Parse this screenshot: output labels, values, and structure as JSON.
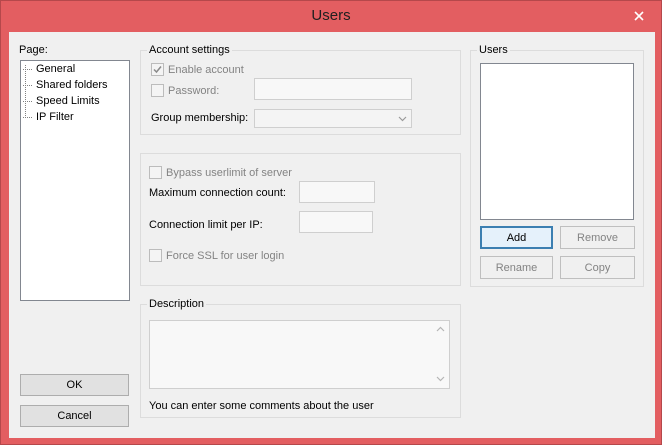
{
  "window": {
    "title": "Users",
    "close_glyph": "close-icon"
  },
  "page_panel": {
    "label": "Page:",
    "items": [
      "General",
      "Shared folders",
      "Speed Limits",
      "IP Filter"
    ]
  },
  "account_settings": {
    "group_label": "Account settings",
    "enable_account_label": "Enable account",
    "enable_account_checked": true,
    "password_label": "Password:",
    "password_checked": false,
    "password_value": "",
    "group_membership_label": "Group membership:",
    "group_membership_value": ""
  },
  "limits": {
    "bypass_label": "Bypass userlimit of server",
    "bypass_checked": false,
    "max_conn_label": "Maximum connection count:",
    "max_conn_value": "",
    "conn_per_ip_label": "Connection limit per IP:",
    "conn_per_ip_value": "",
    "force_ssl_label": "Force SSL for user login",
    "force_ssl_checked": false
  },
  "description": {
    "group_label": "Description",
    "value": "",
    "hint": "You can enter some comments about the user"
  },
  "users_panel": {
    "group_label": "Users",
    "items": [],
    "add_label": "Add",
    "remove_label": "Remove",
    "rename_label": "Rename",
    "copy_label": "Copy"
  },
  "footer": {
    "ok_label": "OK",
    "cancel_label": "Cancel"
  },
  "colors": {
    "frame": "#e35e61",
    "client": "#f0f0f0",
    "disabled_text": "#838383",
    "default_button_border": "#3c7fb1"
  }
}
